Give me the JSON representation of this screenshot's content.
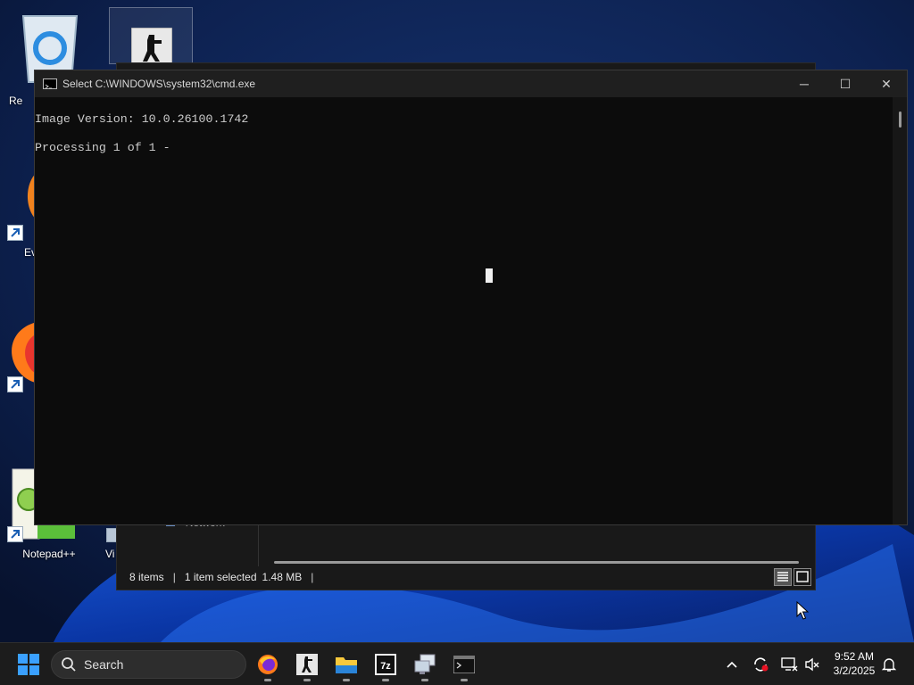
{
  "desktop": {
    "icons": [
      {
        "name": "recycle-bin",
        "label": "Re"
      },
      {
        "name": "counter-strike",
        "label": ""
      },
      {
        "name": "everything",
        "label": "Ev"
      },
      {
        "name": "firefox",
        "label": ""
      },
      {
        "name": "notepad-plus-plus",
        "label": "Notepad++"
      },
      {
        "name": "vm-shortcut",
        "label": "Vi"
      }
    ]
  },
  "explorer": {
    "nav_item": "Network",
    "status": {
      "items": "8 items",
      "selected": "1 item selected",
      "size": "1.48 MB"
    }
  },
  "cmd": {
    "title": "Select C:\\WINDOWS\\system32\\cmd.exe",
    "lines": [
      "Image Version: 10.0.26100.1742",
      "Processing 1 of 1 -"
    ],
    "buttons": {
      "minimize": "─",
      "maximize": "☐",
      "close": "✕"
    }
  },
  "taskbar": {
    "search_label": "Search",
    "pinned": [
      "firefox",
      "counter-strike",
      "file-explorer",
      "7-zip",
      "remote-desktop",
      "terminal"
    ],
    "clock": {
      "time": "9:52 AM",
      "date": "3/2/2025"
    }
  },
  "colors": {
    "console_bg": "#0c0c0c",
    "console_text": "#cccccc",
    "taskbar_bg": "#1c1c1c",
    "accent": "#0078d4"
  }
}
